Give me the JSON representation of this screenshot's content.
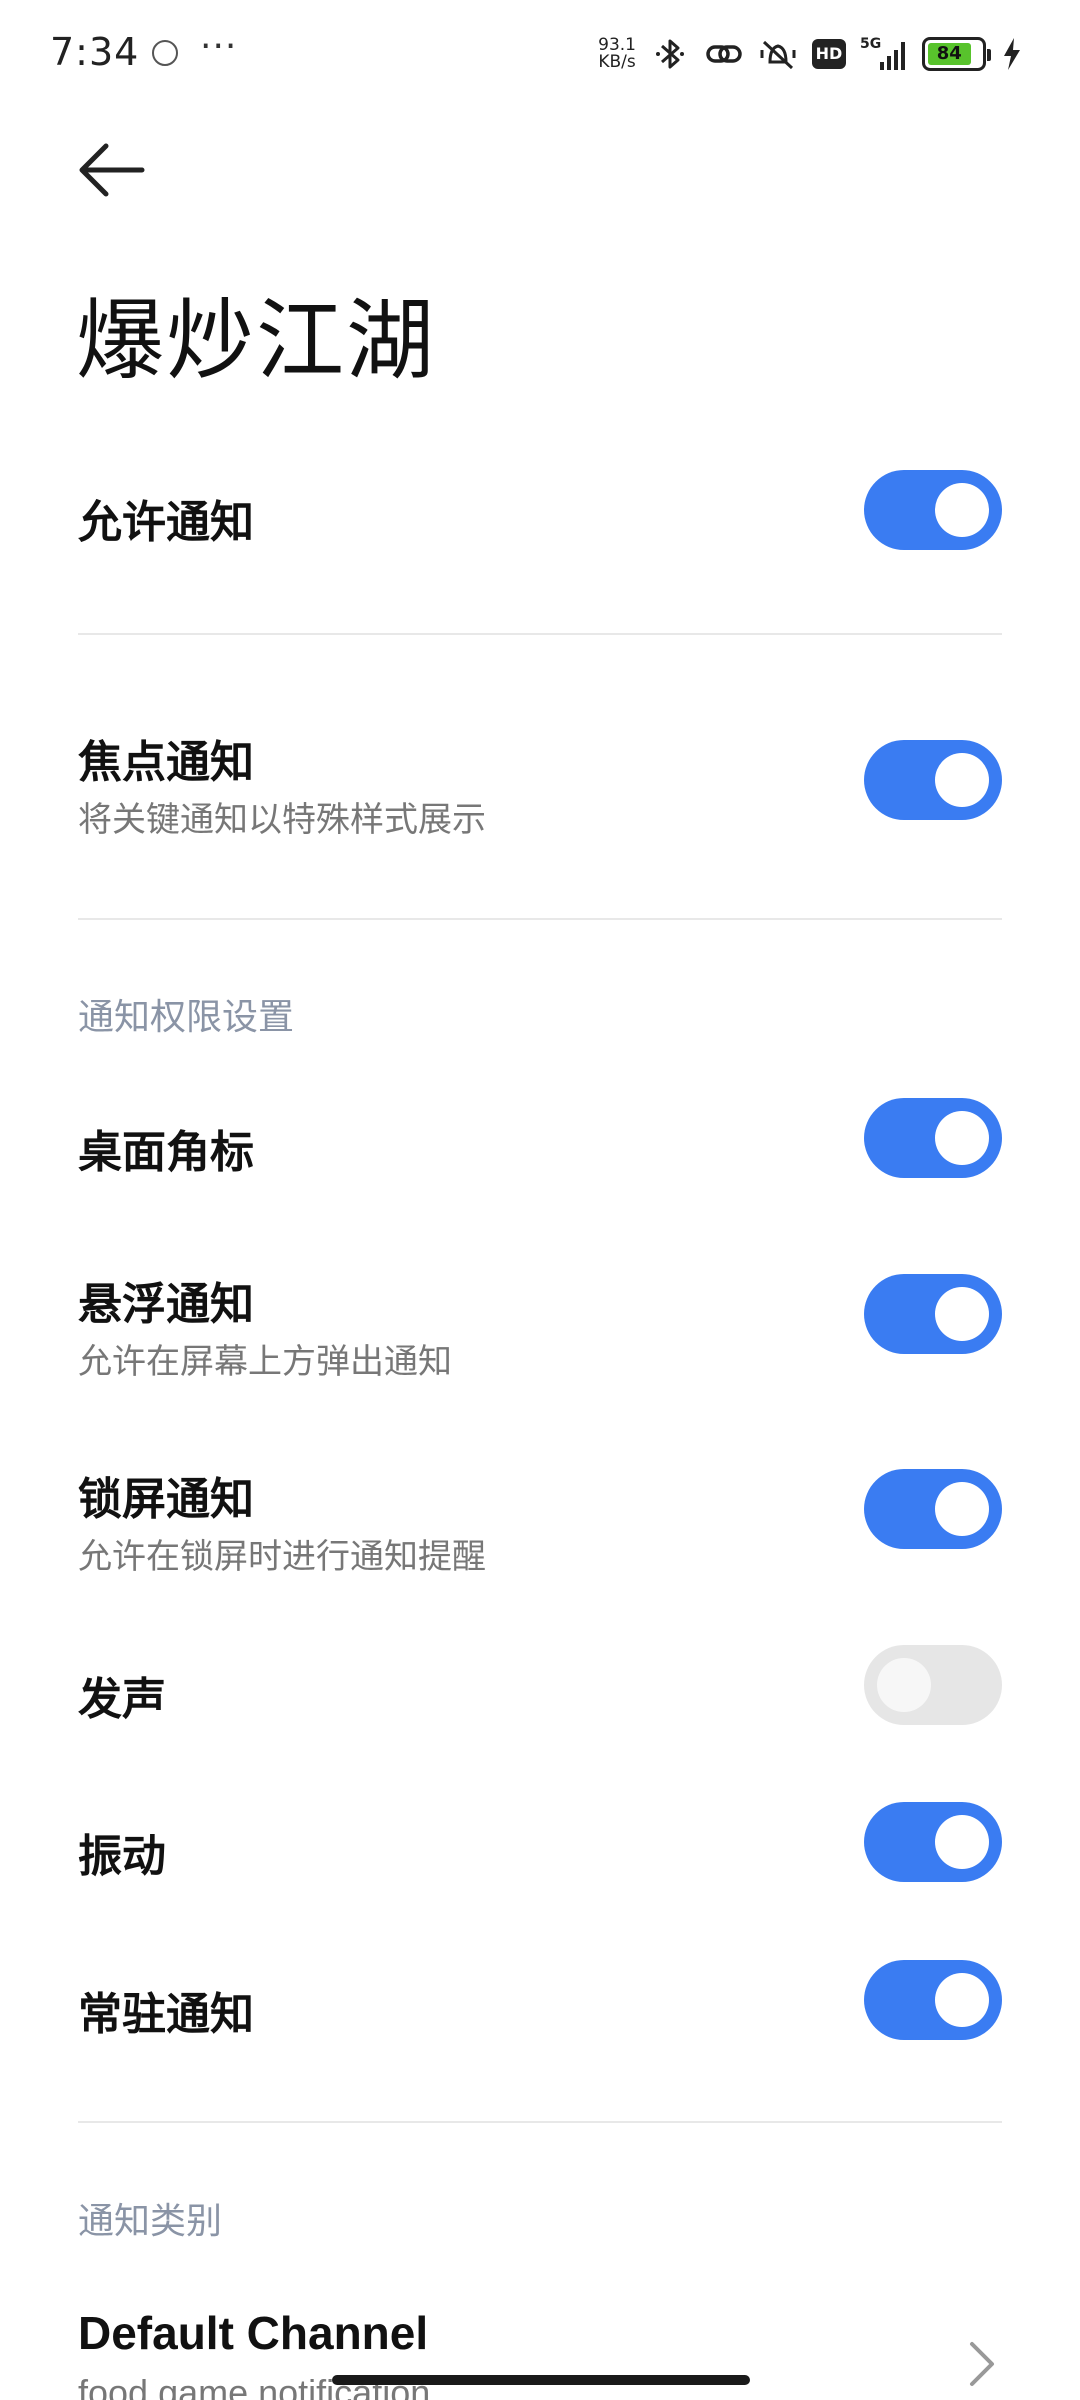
{
  "status_bar": {
    "time": "7:34",
    "more": "···",
    "net_speed_value": "93.1",
    "net_speed_unit": "KB/s",
    "hd": "HD",
    "signal": "5G",
    "battery": "84"
  },
  "header": {
    "title": "爆炒江湖"
  },
  "settings": {
    "allow_notifications": {
      "title": "允许通知",
      "enabled": true
    },
    "focus_notifications": {
      "title": "焦点通知",
      "subtitle": "将关键通知以特殊样式展示",
      "enabled": true
    },
    "permission_section": "通知权限设置",
    "badge": {
      "title": "桌面角标",
      "enabled": true
    },
    "floating": {
      "title": "悬浮通知",
      "subtitle": "允许在屏幕上方弹出通知",
      "enabled": true
    },
    "lockscreen": {
      "title": "锁屏通知",
      "subtitle": "允许在锁屏时进行通知提醒",
      "enabled": true
    },
    "sound": {
      "title": "发声",
      "enabled": false
    },
    "vibration": {
      "title": "振动",
      "enabled": true
    },
    "persistent": {
      "title": "常驻通知",
      "enabled": true
    },
    "category_section": "通知类别",
    "default_channel": {
      "title": "Default Channel",
      "subtitle": "food game notification"
    }
  },
  "colors": {
    "accent": "#3a7cf2",
    "toggle_off": "#e6e6e6",
    "section_header": "#8a94a6"
  }
}
